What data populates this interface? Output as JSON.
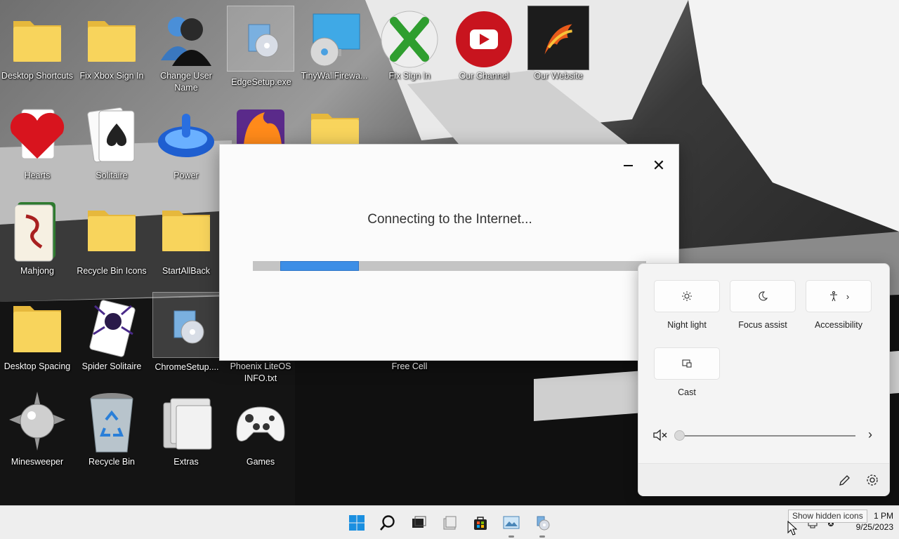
{
  "desktop": {
    "icons": [
      {
        "name": "desktop-shortcuts",
        "label": "Desktop Shortcuts"
      },
      {
        "name": "fix-xbox-sign-in",
        "label": "Fix Xbox Sign In"
      },
      {
        "name": "change-user-name",
        "label": "Change User Name"
      },
      {
        "name": "edge-setup",
        "label": "EdgeSetup.exe"
      },
      {
        "name": "tinywall-firewall",
        "label": "TinyWallFirewa..."
      },
      {
        "name": "fix-sign-in",
        "label": "Fix Sign In"
      },
      {
        "name": "our-channel",
        "label": "Our Channel"
      },
      {
        "name": "our-website",
        "label": "Our Website"
      },
      {
        "name": "hearts",
        "label": "Hearts"
      },
      {
        "name": "solitaire",
        "label": "Solitaire"
      },
      {
        "name": "power",
        "label": "Power"
      },
      {
        "name": "mahjong",
        "label": "Mahjong"
      },
      {
        "name": "recycle-bin-icons",
        "label": "Recycle Bin Icons"
      },
      {
        "name": "startallback",
        "label": "StartAllBack"
      },
      {
        "name": "desktop-spacing",
        "label": "Desktop Spacing"
      },
      {
        "name": "spider-solitaire",
        "label": "Spider Solitaire"
      },
      {
        "name": "chrome-setup",
        "label": "ChromeSetup...."
      },
      {
        "name": "phoenix-liteos-info",
        "label": "Phoenix LiteOS INFO.txt"
      },
      {
        "name": "free-cell",
        "label": "Free Cell"
      },
      {
        "name": "minesweeper",
        "label": "Minesweeper"
      },
      {
        "name": "recycle-bin",
        "label": "Recycle Bin"
      },
      {
        "name": "extras",
        "label": "Extras"
      },
      {
        "name": "games",
        "label": "Games"
      }
    ]
  },
  "dialog": {
    "message": "Connecting to the Internet...",
    "progress_start_fraction": 0.07,
    "progress_fill_fraction": 0.2
  },
  "quick_settings": {
    "tiles": [
      {
        "label": "Night light",
        "icon": "brightness-icon"
      },
      {
        "label": "Focus assist",
        "icon": "moon-icon"
      },
      {
        "label": "Accessibility",
        "icon": "accessibility-icon"
      },
      {
        "label": "Cast",
        "icon": "cast-icon"
      }
    ],
    "volume_level": 0,
    "volume_icon": "speaker-muted-icon"
  },
  "taskbar": {
    "apps": [
      "start-icon",
      "search-icon",
      "task-view-icon",
      "file-explorer-icon",
      "store-icon",
      "photos-icon",
      "setup-icon"
    ],
    "time": "1 PM",
    "date": "9/25/2023",
    "tooltip": "Show hidden icons"
  },
  "colors": {
    "accent": "#3c8ee6",
    "folder": "#f8d45c",
    "taskbar": "#eeeeee"
  }
}
